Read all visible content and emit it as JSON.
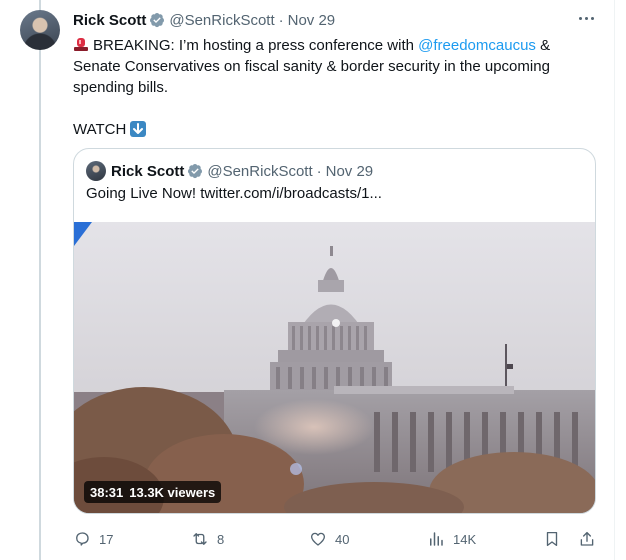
{
  "tweet": {
    "name": "Rick Scott",
    "handle": "@SenRickScott",
    "separator": "·",
    "time": "Nov 29",
    "text_before_mention": "BREAKING: I’m hosting a press conference with ",
    "mention": "@freedomcaucus",
    "text_after_mention": " & Senate Conservatives on fiscal sanity & border security in the upcoming spending bills.",
    "watch_label": "WATCH"
  },
  "quoted_tweet": {
    "name": "Rick Scott",
    "handle": "@SenRickScott",
    "separator": "·",
    "time": "Nov 29",
    "text": "Going Live Now! twitter.com/i/broadcasts/1...",
    "broadcast": {
      "duration": "38:31",
      "viewers": "13.3K viewers"
    }
  },
  "actions": {
    "replies": "17",
    "reposts": "8",
    "likes": "40",
    "views": "14K"
  },
  "icons": {
    "verified": "verified-badge-icon",
    "siren": "police-light-emoji",
    "arrow": "down-arrow-emoji",
    "more": "more-options-icon",
    "reply": "reply-icon",
    "repost": "repost-icon",
    "like": "heart-icon",
    "views": "analytics-icon",
    "bookmark": "bookmark-icon",
    "share": "share-icon"
  },
  "colors": {
    "link": "#1d9bf0",
    "secondary_text": "#536471",
    "border": "#cfd9de",
    "verified_badge": "#829aab"
  }
}
